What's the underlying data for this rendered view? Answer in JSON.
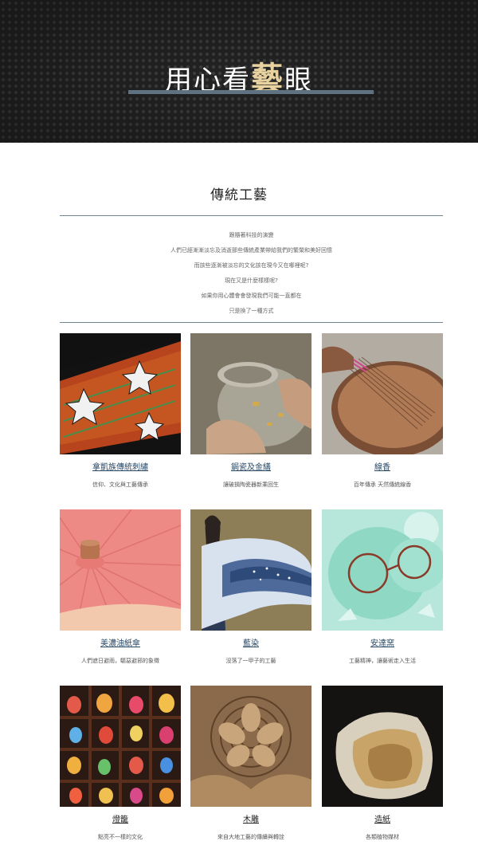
{
  "hero": {
    "title_pre": "用心看",
    "title_accent": "藝",
    "title_post": "眼"
  },
  "section": {
    "title": "傳統工藝",
    "intro": [
      "跟隨著科技的演變",
      "人們已經漸漸淡忘及消逝那些傳統產業帶給我們的繁榮和美好回憶",
      "而該些逐漸被淡忘的文化該在現今又在哪裡呢?",
      "現在又是什麼樣樣呢?",
      "如果你用心體會會發現我們可能一直都在",
      "只是換了一種方式"
    ]
  },
  "cards": [
    {
      "title": "拿凱族傳統刺繡",
      "desc": "信仰、文化與工藝傳承",
      "image": "embroidery"
    },
    {
      "title": "鋦瓷及金繕",
      "desc": "讓破損陶瓷器新乘回生",
      "image": "tea-bowl-repair"
    },
    {
      "title": "線香",
      "desc": "百年傳承 天然傳統線香",
      "image": "incense"
    },
    {
      "title": "美濃油紙傘",
      "desc": "人們遮日避雨，驅惡避邪的象徵",
      "image": "oil-paper-umbrella"
    },
    {
      "title": "藍染",
      "desc": "沒落了一甲子的工藝",
      "image": "indigo-dye"
    },
    {
      "title": "安達窯",
      "desc": "工藝精神，讓藝術走入生活",
      "image": "celadon-glasses"
    },
    {
      "title": "燈籠",
      "desc": "點亮不一樣的文化",
      "image": "lanterns"
    },
    {
      "title": "木雕",
      "desc": "來自大地工藝的傳續與轉詮",
      "image": "wood-carving"
    },
    {
      "title": "造紙",
      "desc": "各類植物媒材",
      "image": "paper"
    }
  ],
  "colors": {
    "hero_bg": "#262626",
    "accent": "#e8d2a0",
    "rule": "#5e7281",
    "link": "#2a4a66"
  }
}
